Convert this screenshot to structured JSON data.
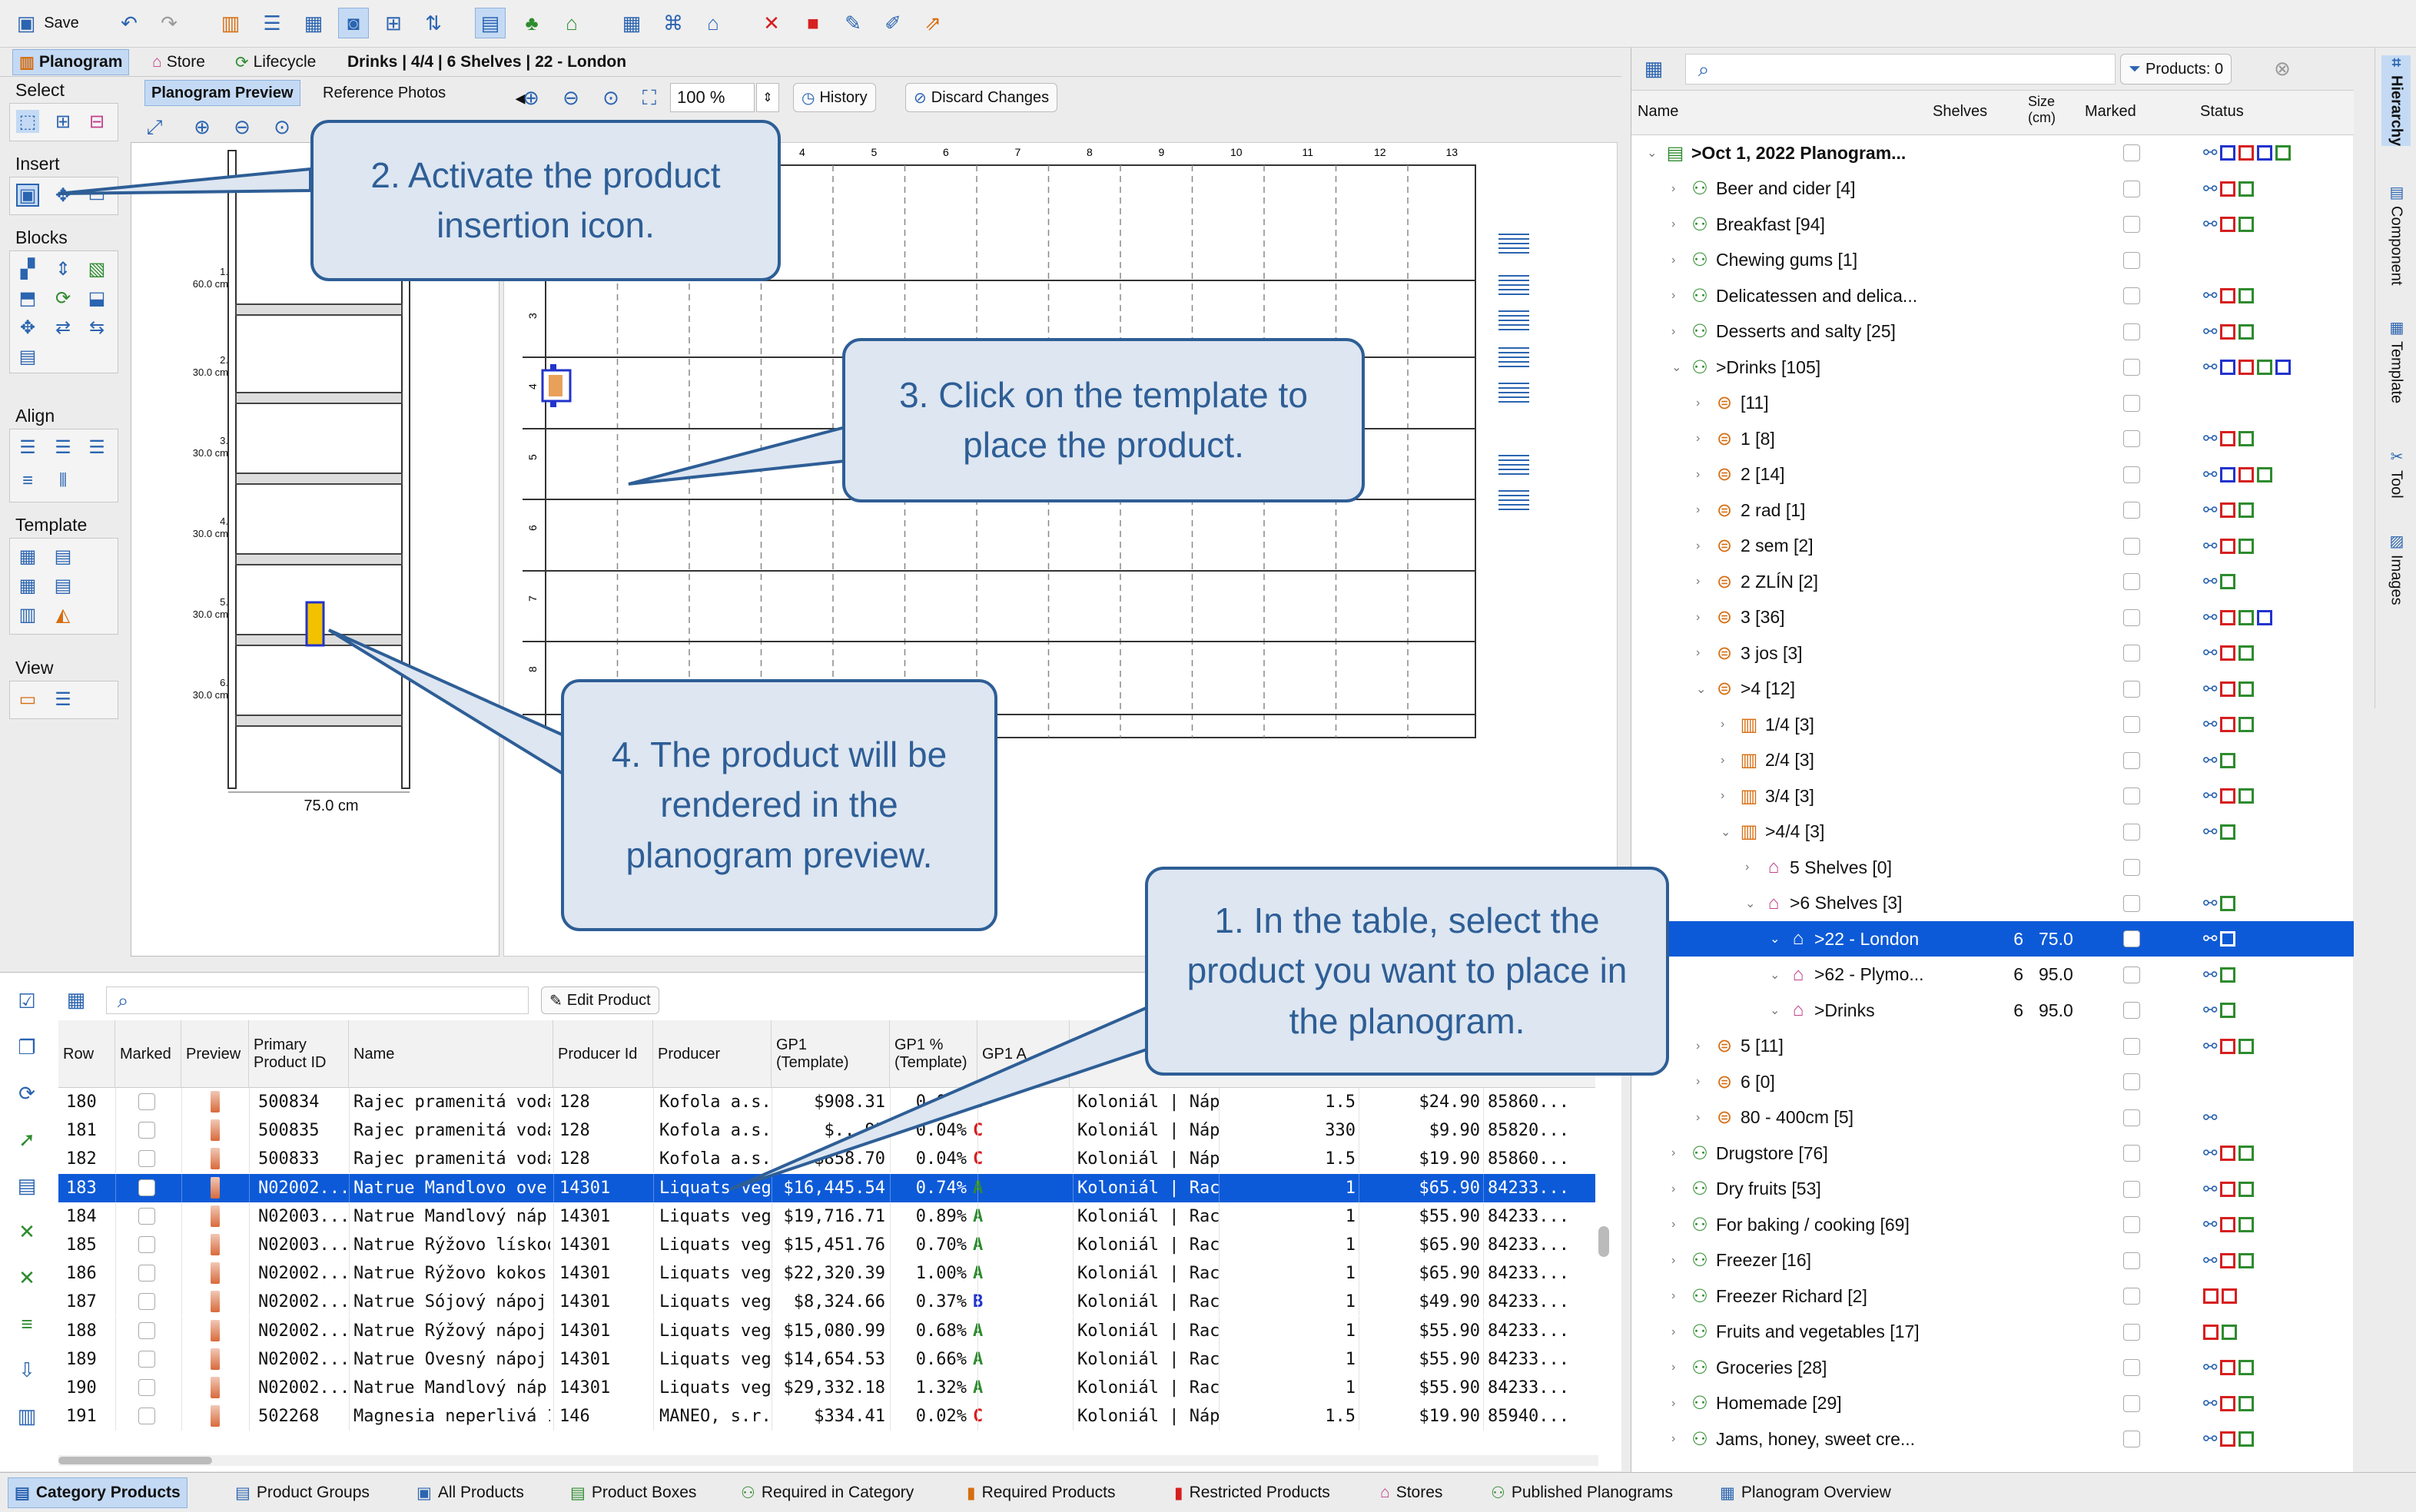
{
  "toolbar": {
    "save_label": "Save"
  },
  "tabs": {
    "planogram": "Planogram",
    "store": "Store",
    "lifecycle": "Lifecycle",
    "breadcrumb": "Drinks | 4/4 | 6 Shelves | 22 - London"
  },
  "subtabs": {
    "preview": "Planogram Preview",
    "photos": "Reference Photos"
  },
  "zoom": {
    "value": "100 %",
    "history": "History",
    "discard": "Discard Changes"
  },
  "tools": {
    "select": "Select",
    "insert": "Insert",
    "blocks": "Blocks",
    "align": "Align",
    "template": "Template",
    "view": "View"
  },
  "preview": {
    "width_label": "75.0 cm",
    "shelves": [
      {
        "num": "1.",
        "size": "60.0 cm"
      },
      {
        "num": "2.",
        "size": "30.0 cm"
      },
      {
        "num": "3.",
        "size": "30.0 cm"
      },
      {
        "num": "4.",
        "size": "30.0 cm"
      },
      {
        "num": "5.",
        "size": "30.0 cm"
      },
      {
        "num": "6.",
        "size": "30.0 cm"
      }
    ]
  },
  "grid": {
    "cols": [
      "4",
      "5",
      "6",
      "7",
      "8",
      "9",
      "10",
      "11",
      "12",
      "13"
    ],
    "rows": [
      "3",
      "4",
      "5",
      "6",
      "7",
      "8"
    ]
  },
  "right": {
    "products_filter": "Products: 0",
    "headers": {
      "name": "Name",
      "shelves": "Shelves",
      "size": "Size\n(cm)",
      "marked": "Marked",
      "status": "Status"
    },
    "rows": [
      {
        "label": ">Oct 1, 2022 Planogram...",
        "indent": 0,
        "icon": "planogram-icon",
        "status": "gbrbg",
        "bold": true
      },
      {
        "label": "Beer and cider [4]",
        "indent": 1,
        "icon": "group",
        "status": "grg"
      },
      {
        "label": "Breakfast [94]",
        "indent": 1,
        "icon": "group",
        "status": "grg"
      },
      {
        "label": "Chewing gums [1]",
        "indent": 1,
        "icon": "group",
        "status": ""
      },
      {
        "label": "Delicatessen and delica...",
        "indent": 1,
        "icon": "group",
        "status": "grg"
      },
      {
        "label": "Desserts and salty [25]",
        "indent": 1,
        "icon": "group",
        "status": "grg"
      },
      {
        "label": ">Drinks [105]",
        "indent": 1,
        "icon": "group",
        "status": "gbrgb"
      },
      {
        "label": "[11]",
        "indent": 2,
        "icon": "shelf",
        "status": ""
      },
      {
        "label": "1 [8]",
        "indent": 2,
        "icon": "shelf",
        "status": "grg"
      },
      {
        "label": "2 [14]",
        "indent": 2,
        "icon": "shelf",
        "status": "gbrg"
      },
      {
        "label": "2 rad [1]",
        "indent": 2,
        "icon": "shelf",
        "status": "grg"
      },
      {
        "label": "2 sem [2]",
        "indent": 2,
        "icon": "shelf",
        "status": "grg"
      },
      {
        "label": "2 ZLÍN [2]",
        "indent": 2,
        "icon": "shelf",
        "status": "gg"
      },
      {
        "label": "3 [36]",
        "indent": 2,
        "icon": "shelf",
        "status": "grgb"
      },
      {
        "label": "3 jos [3]",
        "indent": 2,
        "icon": "shelf",
        "status": "grg"
      },
      {
        "label": ">4 [12]",
        "indent": 2,
        "icon": "shelf",
        "status": "grg"
      },
      {
        "label": "1/4 [3]",
        "indent": 3,
        "icon": "gondola",
        "status": "grg"
      },
      {
        "label": "2/4 [3]",
        "indent": 3,
        "icon": "gondola",
        "status": "gg"
      },
      {
        "label": "3/4 [3]",
        "indent": 3,
        "icon": "gondola",
        "status": "grg"
      },
      {
        "label": ">4/4 [3]",
        "indent": 3,
        "icon": "gondola",
        "status": "gg"
      },
      {
        "label": "5 Shelves [0]",
        "indent": 4,
        "icon": "store",
        "status": ""
      },
      {
        "label": ">6 Shelves [3]",
        "indent": 4,
        "icon": "store",
        "status": "gg"
      },
      {
        "label": ">22 - London",
        "indent": 5,
        "icon": "store",
        "status": "gg",
        "shelves": "6",
        "size": "75.0",
        "selected": true
      },
      {
        "label": ">62 - Plymo...",
        "indent": 5,
        "icon": "store",
        "status": "gg",
        "shelves": "6",
        "size": "95.0"
      },
      {
        "label": ">Drinks",
        "indent": 5,
        "icon": "store",
        "status": "gg",
        "shelves": "6",
        "size": "95.0"
      },
      {
        "label": "5 [11]",
        "indent": 2,
        "icon": "shelf",
        "status": "grg"
      },
      {
        "label": "6 [0]",
        "indent": 2,
        "icon": "shelf",
        "status": ""
      },
      {
        "label": "80 - 400cm [5]",
        "indent": 2,
        "icon": "shelf",
        "status": "g"
      },
      {
        "label": "Drugstore [76]",
        "indent": 1,
        "icon": "group",
        "status": "grg"
      },
      {
        "label": "Dry fruits [53]",
        "indent": 1,
        "icon": "group",
        "status": "grg"
      },
      {
        "label": "For baking / cooking [69]",
        "indent": 1,
        "icon": "group",
        "status": "grg"
      },
      {
        "label": "Freezer [16]",
        "indent": 1,
        "icon": "group",
        "status": "grg"
      },
      {
        "label": "Freezer Richard [2]",
        "indent": 1,
        "icon": "group",
        "status": "rr"
      },
      {
        "label": "Fruits and vegetables [17]",
        "indent": 1,
        "icon": "group",
        "status": "rg"
      },
      {
        "label": "Groceries [28]",
        "indent": 1,
        "icon": "group",
        "status": "grg"
      },
      {
        "label": "Homemade [29]",
        "indent": 1,
        "icon": "group",
        "status": "grg"
      },
      {
        "label": "Jams, honey, sweet cre...",
        "indent": 1,
        "icon": "group",
        "status": "grg"
      }
    ]
  },
  "vtabs": [
    "Hierarchy",
    "Component",
    "Template",
    "Tool",
    "Images"
  ],
  "table": {
    "edit_label": "Edit Product",
    "headers": [
      "Row",
      "Marked",
      "Preview",
      "Primary\nProduct ID",
      "Name",
      "Producer Id",
      "Producer",
      "GP1\n(Template)",
      "GP1 %\n(Template)",
      "GP1 A"
    ],
    "rows": [
      {
        "row": "180",
        "id": "500834",
        "name": "Rajec pramenitá voda...",
        "pid": "128",
        "producer": "Kofola a.s.",
        "gp1": "$908.31",
        "gp1p": "0.04%",
        "abc": "C",
        "cat": "Koloniál | Náp...",
        "qty": "1.5",
        "price": "$24.90",
        "ean": "85860..."
      },
      {
        "row": "181",
        "id": "500835",
        "name": "Rajec pramenitá voda...",
        "pid": "128",
        "producer": "Kofola a.s.",
        "gp1": "$...95",
        "gp1p": "0.04%",
        "abc": "C",
        "cat": "Koloniál | Náp...",
        "qty": "330",
        "price": "$9.90",
        "ean": "85820..."
      },
      {
        "row": "182",
        "id": "500833",
        "name": "Rajec pramenitá voda...",
        "pid": "128",
        "producer": "Kofola a.s.",
        "gp1": "$858.70",
        "gp1p": "0.04%",
        "abc": "C",
        "cat": "Koloniál | Náp...",
        "qty": "1.5",
        "price": "$19.90",
        "ean": "85860..."
      },
      {
        "row": "183",
        "id": "N02002...",
        "name": "Natrue Mandlovo ove...",
        "pid": "14301",
        "producer": "Liquats veg...",
        "gp1": "$16,445.54",
        "gp1p": "0.74%",
        "abc": "A",
        "cat": "Koloniál | Raci...",
        "qty": "1",
        "price": "$65.90",
        "ean": "84233...",
        "selected": true
      },
      {
        "row": "184",
        "id": "N02003...",
        "name": "Natrue Mandlový náp...",
        "pid": "14301",
        "producer": "Liquats veg...",
        "gp1": "$19,716.71",
        "gp1p": "0.89%",
        "abc": "A",
        "cat": "Koloniál | Raci...",
        "qty": "1",
        "price": "$55.90",
        "ean": "84233..."
      },
      {
        "row": "185",
        "id": "N02003...",
        "name": "Natrue Rýžovo lískoor...",
        "pid": "14301",
        "producer": "Liquats veg...",
        "gp1": "$15,451.76",
        "gp1p": "0.70%",
        "abc": "A",
        "cat": "Koloniál | Raci...",
        "qty": "1",
        "price": "$65.90",
        "ean": "84233..."
      },
      {
        "row": "186",
        "id": "N02002...",
        "name": "Natrue Rýžovo kokos...",
        "pid": "14301",
        "producer": "Liquats veg...",
        "gp1": "$22,320.39",
        "gp1p": "1.00%",
        "abc": "A",
        "cat": "Koloniál | Raci...",
        "qty": "1",
        "price": "$65.90",
        "ean": "84233..."
      },
      {
        "row": "187",
        "id": "N02002...",
        "name": "Natrue Sójový nápoj s...",
        "pid": "14301",
        "producer": "Liquats veg...",
        "gp1": "$8,324.66",
        "gp1p": "0.37%",
        "abc": "B",
        "cat": "Koloniál | Raci...",
        "qty": "1",
        "price": "$49.90",
        "ean": "84233..."
      },
      {
        "row": "188",
        "id": "N02002...",
        "name": "Natrue Rýžový nápoj 1 l",
        "pid": "14301",
        "producer": "Liquats veg...",
        "gp1": "$15,080.99",
        "gp1p": "0.68%",
        "abc": "A",
        "cat": "Koloniál | Raci...",
        "qty": "1",
        "price": "$55.90",
        "ean": "84233..."
      },
      {
        "row": "189",
        "id": "N02002...",
        "name": "Natrue Ovesný nápoj ...",
        "pid": "14301",
        "producer": "Liquats veg...",
        "gp1": "$14,654.53",
        "gp1p": "0.66%",
        "abc": "A",
        "cat": "Koloniál | Raci...",
        "qty": "1",
        "price": "$55.90",
        "ean": "84233..."
      },
      {
        "row": "190",
        "id": "N02002...",
        "name": "Natrue Mandlový náp...",
        "pid": "14301",
        "producer": "Liquats veg...",
        "gp1": "$29,332.18",
        "gp1p": "1.32%",
        "abc": "A",
        "cat": "Koloniál | Raci...",
        "qty": "1",
        "price": "$55.90",
        "ean": "84233..."
      },
      {
        "row": "191",
        "id": "502268",
        "name": "Magnesia neperlivá 1,...",
        "pid": "146",
        "producer": "MANEO, s.r...",
        "gp1": "$334.41",
        "gp1p": "0.02%",
        "abc": "C",
        "cat": "Koloniál | Náp...",
        "qty": "1.5",
        "price": "$19.90",
        "ean": "85940..."
      }
    ]
  },
  "statusbar": [
    "Category Products",
    "Product Groups",
    "All Products",
    "Product Boxes",
    "Required in Category",
    "Required Products",
    "Restricted Products",
    "Stores",
    "Published Planograms",
    "Planogram Overview"
  ],
  "callouts": {
    "c1": "1. In the table, select the product you want to place in the planogram.",
    "c2": "2. Activate the product insertion icon.",
    "c3": "3. Click on the template to place the product.",
    "c4": "4. The product will be rendered in the planogram preview."
  },
  "colors": {
    "accent": "#0d5ad8",
    "callout_border": "#2e5e96",
    "callout_bg": "#dde6f1",
    "tab_active": "#c4daf4"
  }
}
